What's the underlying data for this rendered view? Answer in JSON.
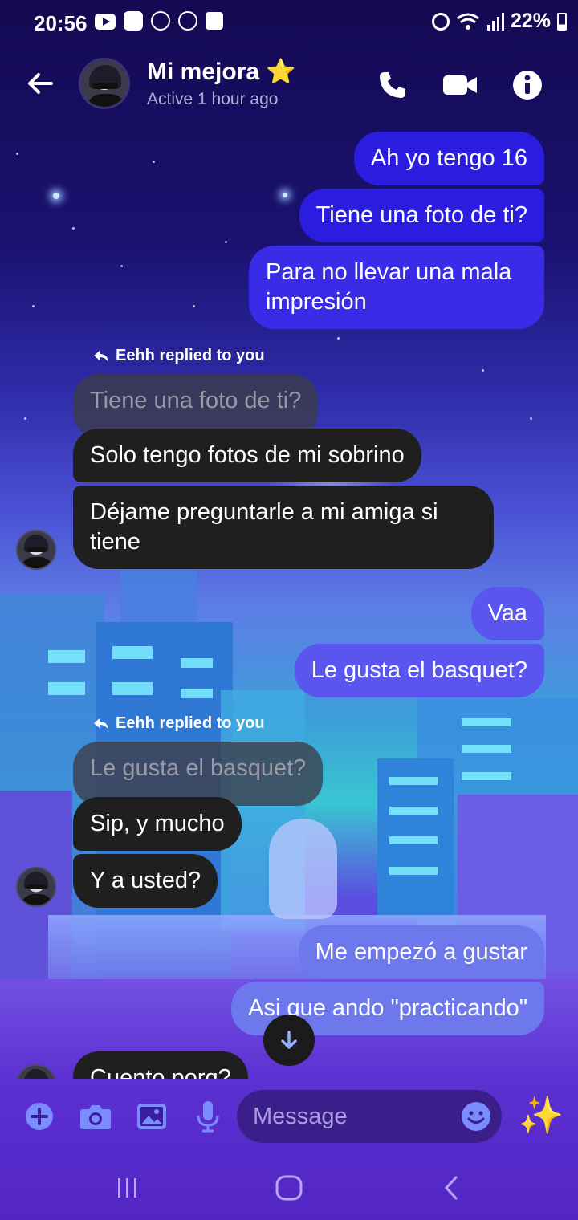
{
  "status_bar": {
    "time": "20:56",
    "battery": "22%"
  },
  "header": {
    "contact_name": "Mi mejora",
    "name_emoji": "⭐",
    "active_status": "Active 1 hour ago"
  },
  "messages": [
    {
      "id": "m1",
      "direction": "outgoing",
      "text": "Ah yo tengo 16",
      "color": "#2a1de0"
    },
    {
      "id": "m2",
      "direction": "outgoing",
      "text": "Tiene una foto de ti?",
      "color": "#2a1de0"
    },
    {
      "id": "m3",
      "direction": "outgoing",
      "text": "Para no llevar una mala impresión",
      "color": "#3a2be6"
    },
    {
      "id": "r1",
      "type": "reply_note",
      "text": "Eehh replied to you"
    },
    {
      "id": "q1",
      "type": "quoted",
      "text": "Tiene una foto de ti?"
    },
    {
      "id": "m4",
      "direction": "incoming",
      "text": "Solo tengo fotos de mi sobrino"
    },
    {
      "id": "m5",
      "direction": "incoming",
      "text": "Déjame preguntarle a mi amiga si tiene"
    },
    {
      "id": "m6",
      "direction": "outgoing",
      "text": "Vaa",
      "color": "#5b55f0"
    },
    {
      "id": "m7",
      "direction": "outgoing",
      "text": "Le gusta el basquet?",
      "color": "#5b55f0"
    },
    {
      "id": "r2",
      "type": "reply_note",
      "text": "Eehh replied to you"
    },
    {
      "id": "q2",
      "type": "quoted",
      "text": "Le gusta el basquet?"
    },
    {
      "id": "m8",
      "direction": "incoming",
      "text": "Sip, y mucho"
    },
    {
      "id": "m9",
      "direction": "incoming",
      "text": "Y a usted?"
    },
    {
      "id": "m10",
      "direction": "outgoing",
      "text": "Me empezó a gustar",
      "color": "#6d78ec"
    },
    {
      "id": "m11",
      "direction": "outgoing",
      "text": "Asi que ando \"practicando\"",
      "color": "#6d78ec"
    },
    {
      "id": "m12",
      "direction": "incoming",
      "text": "Cuento porq?"
    }
  ],
  "composer": {
    "placeholder": "Message",
    "sparkle_emoji": "✨"
  },
  "colors": {
    "incoming_bubble": "#1f1f1f",
    "composer_icons": "#7b8cff",
    "header_bg": "#1a0f5a"
  }
}
